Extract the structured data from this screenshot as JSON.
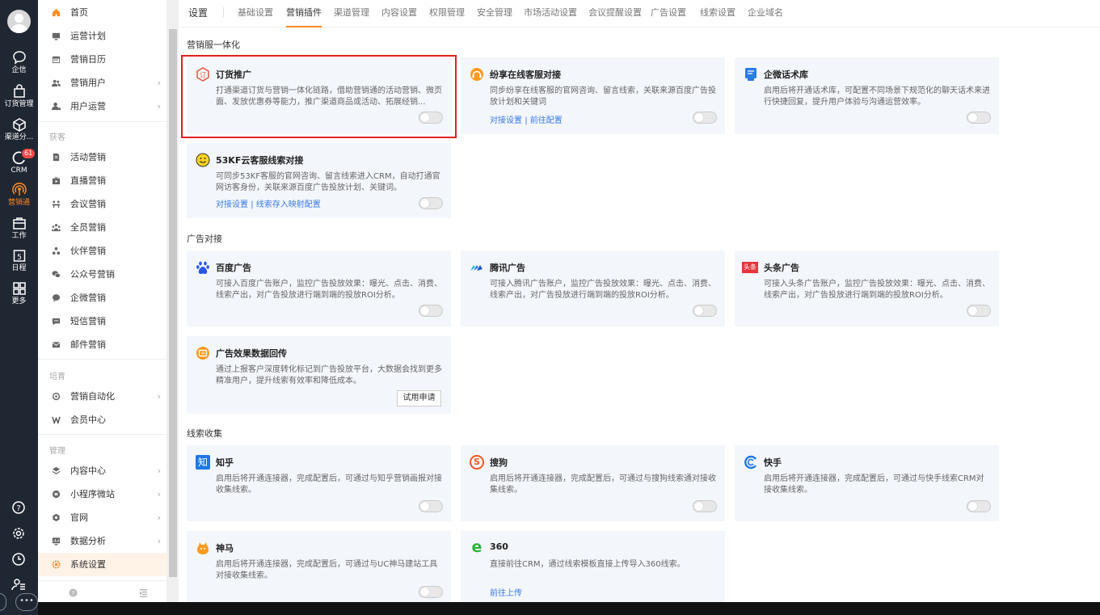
{
  "rail": {
    "items": [
      {
        "label": "企信",
        "icon": "chat-bubble-icon"
      },
      {
        "label": "订货管理",
        "icon": "bag-icon"
      },
      {
        "label": "渠道分...",
        "icon": "box-icon"
      },
      {
        "label": "CRM",
        "icon": "crm-icon",
        "badge": "61"
      },
      {
        "label": "营销通",
        "icon": "broadcast-icon",
        "active": true
      },
      {
        "label": "工作",
        "icon": "briefcase-icon"
      },
      {
        "label": "日程",
        "icon": "calendar-icon",
        "day": "5"
      },
      {
        "label": "更多",
        "icon": "grid-icon"
      }
    ],
    "more": "•••",
    "accent": "#ff8a1f"
  },
  "menu": {
    "items": [
      {
        "label": "首页",
        "icon": "home-icon"
      },
      {
        "label": "运营计划",
        "icon": "plan-icon"
      },
      {
        "label": "营销日历",
        "icon": "calendar-icon"
      },
      {
        "label": "营销用户",
        "icon": "users-icon",
        "arrow": "›"
      },
      {
        "label": "用户运营",
        "icon": "user-ops-icon",
        "arrow": "›"
      }
    ],
    "sec_acquire": "获客",
    "acquire": [
      {
        "label": "活动营销",
        "icon": "doc-icon"
      },
      {
        "label": "直播营销",
        "icon": "live-icon"
      },
      {
        "label": "会议营销",
        "icon": "meeting-icon"
      },
      {
        "label": "全员营销",
        "icon": "team-icon"
      },
      {
        "label": "伙伴营销",
        "icon": "partner-icon"
      },
      {
        "label": "公众号营销",
        "icon": "wechat-icon"
      },
      {
        "label": "企微营销",
        "icon": "wecom-icon"
      },
      {
        "label": "短信营销",
        "icon": "sms-icon"
      },
      {
        "label": "邮件营销",
        "icon": "mail-icon"
      }
    ],
    "sec_nurture": "培育",
    "nurture": [
      {
        "label": "营销自动化",
        "icon": "automation-icon",
        "arrow": "›"
      },
      {
        "label": "会员中心",
        "icon": "member-icon"
      }
    ],
    "sec_manage": "管理",
    "manage": [
      {
        "label": "内容中心",
        "icon": "content-icon",
        "arrow": "›"
      },
      {
        "label": "小程序微站",
        "icon": "miniapp-icon",
        "arrow": "›"
      },
      {
        "label": "官网",
        "icon": "website-icon",
        "arrow": "›"
      },
      {
        "label": "数据分析",
        "icon": "analytics-icon",
        "arrow": "›"
      },
      {
        "label": "系统设置",
        "icon": "settings-icon"
      }
    ]
  },
  "tabs": {
    "settings": "设置",
    "items": [
      "基础设置",
      "营销插件",
      "渠道管理",
      "内容设置",
      "权限管理",
      "安全管理",
      "市场活动设置",
      "会议提醒设置",
      "广告设置",
      "线索设置",
      "企业域名"
    ],
    "active": "营销插件"
  },
  "sections": {
    "s1": "营销服一体化",
    "s2": "广告对接",
    "s3": "线索收集"
  },
  "cards": {
    "order": {
      "title": "订货推广",
      "desc": "打通渠道订货与营销一体化链路，借助营销通的活动营销、微页面、发放优惠券等能力，推广渠道商品或活动、拓展经销..."
    },
    "fenxiang": {
      "title": "纷享在线客服对接",
      "desc": "同步纷享在线客服的官网咨询、留言线索，关联来源百度广告投放计划和关键词",
      "link1": "对接设置",
      "link2": "前往配置"
    },
    "wecom": {
      "title": "企微话术库",
      "desc": "启用后将开通话术库，可配置不同场景下规范化的聊天话术来进行快捷回复，提升用户体验与沟通运营效率。"
    },
    "kf53": {
      "title": "53KF云客服线索对接",
      "desc": "可同步53KF客服的官网咨询、留言线索进入CRM，自动打通官网访客身份，关联来源百度广告投放计划、关键词。",
      "link1": "对接设置",
      "link2": "线索存入映射配置"
    },
    "baidu": {
      "title": "百度广告",
      "desc": "可接入百度广告账户，监控广告投放效果：曝光、点击、消费、线索产出，对广告投放进行端到端的投放ROI分析。"
    },
    "tencent": {
      "title": "腾讯广告",
      "desc": "可接入腾讯广告账户，监控广告投放效果：曝光、点击、消费、线索产出，对广告投放进行端到端的投放ROI分析。"
    },
    "toutiao": {
      "title": "头条广告",
      "desc": "可接入头条广告账户，监控广告投放效果：曝光、点击、消费、线索产出，对广告投放进行端到端的投放ROI分析。",
      "badge": "头条"
    },
    "feedback": {
      "title": "广告效果数据回传",
      "desc": "通过上报客户深度转化标记到广告投放平台，大数据会找到更多精准用户，提升线索有效率和降低成本。",
      "button": "试用申请"
    },
    "zhihu": {
      "title": "知乎",
      "desc": "启用后将开通连接器，完成配置后，可通过与知乎营销画报对接收集线索。",
      "glyph": "知"
    },
    "sogou": {
      "title": "搜狗",
      "desc": "启用后将开通连接器，完成配置后，可通过与搜狗线索通对接收集线索。",
      "glyph": "S"
    },
    "kuaishou": {
      "title": "快手",
      "desc": "启用后将开通连接器，完成配置后，可通过与快手线索CRM对接收集线索。"
    },
    "shenma": {
      "title": "神马",
      "desc": "启用后将开通连接器，完成配置后，可通过与UC神马建站工具对接收集线索。"
    },
    "q360": {
      "title": "360",
      "desc": "直接前往CRM，通过线索模板直接上传导入360线索。",
      "link1": "前往上传",
      "glyph": "e"
    }
  },
  "sep": "|"
}
